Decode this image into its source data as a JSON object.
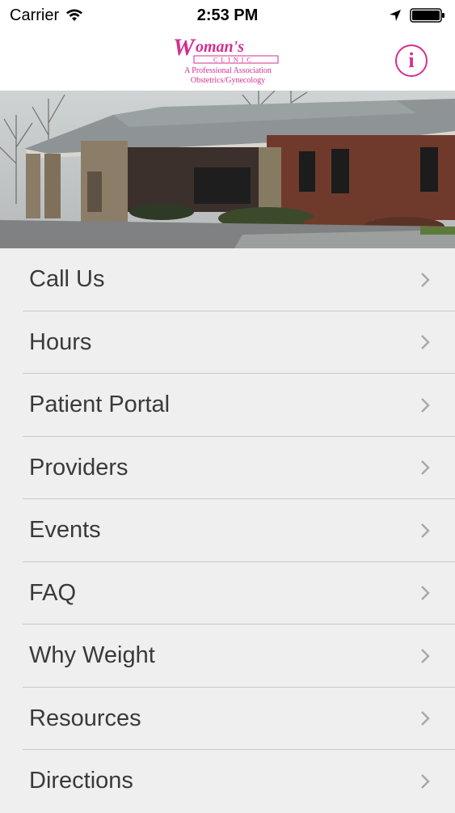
{
  "status_bar": {
    "carrier": "Carrier",
    "time": "2:53 PM"
  },
  "header": {
    "logo_text": "Woman's CLINIC",
    "logo_subtitle_1": "A Professional Association",
    "logo_subtitle_2": "Obstetrics/Gynecology",
    "info_icon": "info-icon",
    "info_glyph": "i",
    "accent_color": "#d32f8f"
  },
  "hero": {
    "image_icon": "clinic-building-photo"
  },
  "menu": {
    "items": [
      {
        "label": "Call Us"
      },
      {
        "label": "Hours"
      },
      {
        "label": "Patient Portal"
      },
      {
        "label": "Providers"
      },
      {
        "label": "Events"
      },
      {
        "label": "FAQ"
      },
      {
        "label": "Why Weight"
      },
      {
        "label": "Resources"
      },
      {
        "label": "Directions"
      }
    ]
  }
}
